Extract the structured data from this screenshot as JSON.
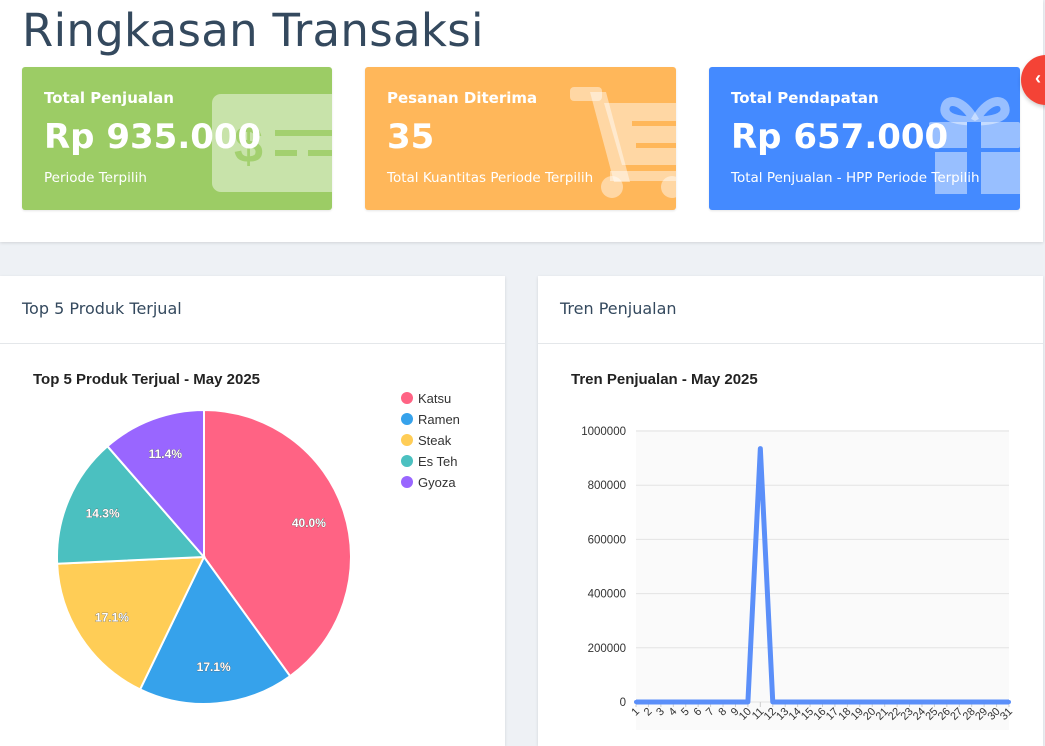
{
  "page": {
    "title": "Ringkasan Transaksi"
  },
  "cards": [
    {
      "title": "Total Penjualan",
      "value": "Rp 935.000",
      "subtitle": "Periode Terpilih",
      "icon": "money-bill-icon",
      "color": "#9ccc65"
    },
    {
      "title": "Pesanan Diterima",
      "value": "35",
      "subtitle": "Total Kuantitas Periode Terpilih",
      "icon": "shopping-cart-icon",
      "color": "#ffb75a"
    },
    {
      "title": "Total Pendapatan",
      "value": "Rp 657.000",
      "subtitle": "Total Penjualan - HPP Periode Terpilih",
      "icon": "gift-icon",
      "color": "#448aff"
    }
  ],
  "floating_button": {
    "icon": "chevron-left-icon",
    "glyph": "‹",
    "color": "#f44336"
  },
  "panels": {
    "top_products": {
      "title": "Top 5 Produk Terjual"
    },
    "sales_trend": {
      "title": "Tren Penjualan"
    }
  },
  "chart_data": [
    {
      "type": "pie",
      "title": "Top 5 Produk Terjual - May 2025",
      "categories": [
        "Katsu",
        "Ramen",
        "Steak",
        "Es Teh",
        "Gyoza"
      ],
      "values": [
        40.0,
        17.1,
        17.1,
        14.3,
        11.4
      ],
      "value_labels": [
        "40.0%",
        "17.1%",
        "17.1%",
        "14.3%",
        "11.4%"
      ],
      "colors": [
        "#ff6384",
        "#36a2eb",
        "#ffcd56",
        "#4bc0c0",
        "#9966ff"
      ],
      "legend": "right"
    },
    {
      "type": "line",
      "title": "Tren Penjualan - May 2025",
      "x": [
        "1",
        "2",
        "3",
        "4",
        "5",
        "6",
        "7",
        "8",
        "9",
        "10",
        "11",
        "12",
        "13",
        "14",
        "15",
        "16",
        "17",
        "18",
        "19",
        "20",
        "21",
        "22",
        "23",
        "24",
        "25",
        "26",
        "27",
        "28",
        "29",
        "30",
        "31"
      ],
      "values": [
        0,
        0,
        0,
        0,
        0,
        0,
        0,
        0,
        0,
        0,
        935000,
        0,
        0,
        0,
        0,
        0,
        0,
        0,
        0,
        0,
        0,
        0,
        0,
        0,
        0,
        0,
        0,
        0,
        0,
        0,
        0
      ],
      "ylim": [
        0,
        1000000
      ],
      "yticks": [
        "0",
        "200000",
        "400000",
        "600000",
        "800000",
        "1000000"
      ],
      "color": "#5b8ff9",
      "grid": true
    }
  ]
}
